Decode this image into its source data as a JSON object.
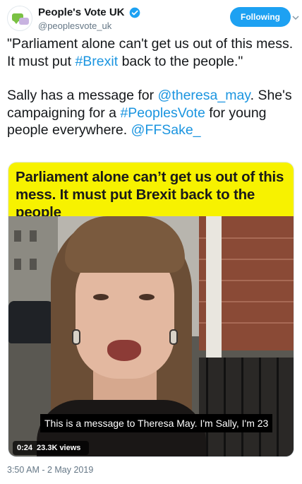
{
  "author": {
    "display_name": "People's Vote UK",
    "handle": "@peoplesvote_uk",
    "follow_label": "Following"
  },
  "tweet": {
    "para1": {
      "part1": "\"Parliament alone can't get us out of this mess. It must put ",
      "hashtag": "#Brexit",
      "part2": " back to the people.\""
    },
    "para2": {
      "part1": "Sally has a message for ",
      "mention1": "@theresa_may",
      "part2": ". She's campaigning for a ",
      "hashtag": "#PeoplesVote",
      "part3": " for young people everywhere. ",
      "mention2": "@FFSake_"
    }
  },
  "media": {
    "banner_text": "Parliament alone can’t get us out of this mess. It must put Brexit back to the people",
    "subtitle": "This is a message to Theresa May. I'm Sally, I'm 23",
    "duration": "0:24",
    "views": "23.3K views"
  },
  "timestamp": "3:50 AM - 2 May 2019",
  "colors": {
    "link": "#1b95e0",
    "follow_button": "#1da1f2",
    "banner": "#f7f200",
    "verified": "#1da1f2"
  },
  "icons": [
    "verified-badge-icon",
    "chevron-down-icon",
    "avatar-logo"
  ]
}
